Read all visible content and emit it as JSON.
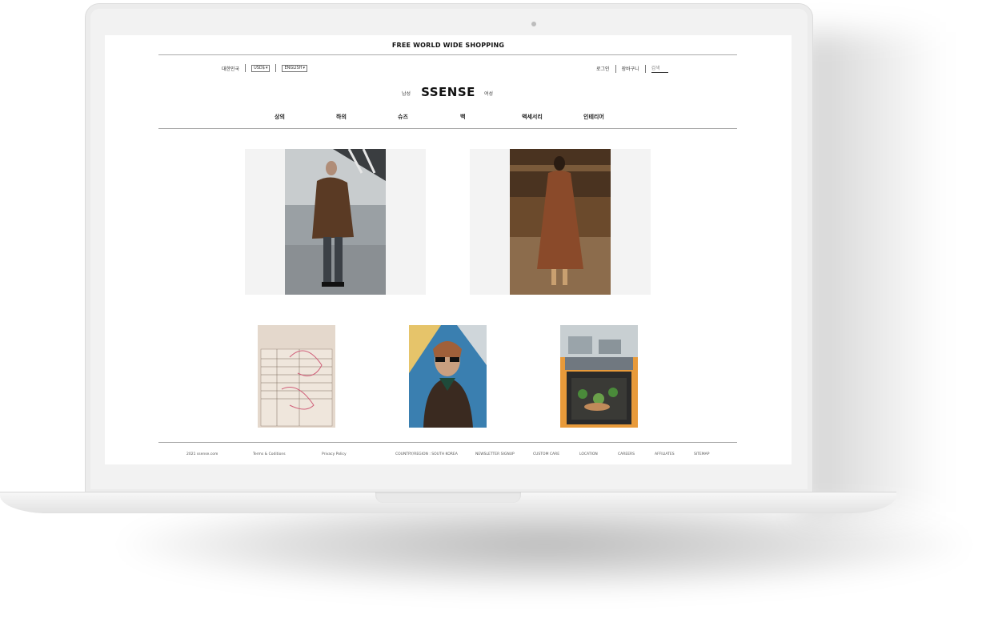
{
  "promo": "FREE WORLD WIDE SHOPPING",
  "utility": {
    "region": "대한민국",
    "currency": "USD$",
    "language": "ENGLISH",
    "login": "로그인",
    "cart": "장바구니",
    "search_placeholder": "검색"
  },
  "brand": {
    "logo": "SSENSE",
    "men": "남성",
    "women": "여성"
  },
  "nav": [
    "상의",
    "하의",
    "슈즈",
    "백",
    "액세서리",
    "인테리어"
  ],
  "footer": {
    "copyright": "2021 ssense.com",
    "terms": "Terms & Coditions",
    "privacy": "Privacy Policy",
    "country": "COUNTRY/REGION : SOUTH KOREA",
    "newsletter": "NEWSLETTER SIGNUP",
    "customer_care": "CUSTOM CARE",
    "location": "LOCATION",
    "careers": "CAREERS",
    "affiliates": "AFFILIATES",
    "sitemap": "SITEMAP"
  }
}
